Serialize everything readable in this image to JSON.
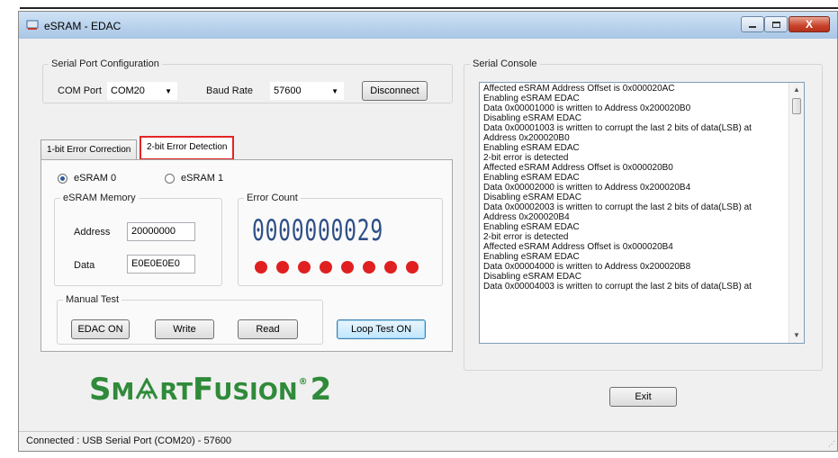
{
  "window": {
    "title": "eSRAM - EDAC",
    "controls": {
      "minimize": "–",
      "maximize": "□",
      "close": "X"
    }
  },
  "serial_config": {
    "legend": "Serial Port Configuration",
    "com_port_label": "COM Port",
    "com_port_value": "COM20",
    "baud_rate_label": "Baud Rate",
    "baud_rate_value": "57600",
    "disconnect_label": "Disconnect"
  },
  "tabs": [
    {
      "label": "1-bit Error Correction",
      "active": false
    },
    {
      "label": "2-bit Error Detection",
      "active": true
    }
  ],
  "panel": {
    "radio_esram0": "eSRAM 0",
    "radio_esram1": "eSRAM 1",
    "selected": "eSRAM 0",
    "memory_legend": "eSRAM Memory",
    "address_label": "Address",
    "address_value": "20000000",
    "data_label": "Data",
    "data_value": "E0E0E0E0",
    "error_count_legend": "Error Count",
    "error_count_value": "0000000029",
    "led_count": 8,
    "led_color": "#e02020",
    "manual_test_legend": "Manual Test",
    "edac_on_label": "EDAC ON",
    "write_label": "Write",
    "read_label": "Read",
    "loop_test_label": "Loop Test ON"
  },
  "console": {
    "legend": "Serial Console",
    "lines": [
      "Affected eSRAM Address Offset is 0x000020AC",
      "Enabling eSRAM EDAC",
      "Data 0x00001000 is written to Address 0x200020B0",
      "Disabling eSRAM EDAC",
      "Data 0x00001003 is written to corrupt the last 2 bits of data(LSB) at",
      "Address 0x200020B0",
      "Enabling eSRAM EDAC",
      "2-bit error is detected",
      "Affected eSRAM Address Offset is 0x000020B0",
      "Enabling eSRAM EDAC",
      "Data 0x00002000 is written to Address 0x200020B4",
      "Disabling eSRAM EDAC",
      "Data 0x00002003 is written to corrupt the last 2 bits of data(LSB) at",
      "Address 0x200020B4",
      "Enabling eSRAM EDAC",
      "2-bit error is detected",
      "Affected eSRAM Address Offset is 0x000020B4",
      "Enabling eSRAM EDAC",
      "Data 0x00004000 is written to Address 0x200020B8",
      "Disabling eSRAM EDAC",
      "Data 0x00004003 is written to corrupt the last 2 bits of data(LSB) at"
    ]
  },
  "logo": {
    "part1_big": "S",
    "part1_small": "M",
    "part1_rest": "RT",
    "part2_big": "F",
    "part2_small": "USION",
    "reg": "®",
    "number": "2",
    "color": "#2f8a3a"
  },
  "exit_label": "Exit",
  "status_bar": "Connected : USB Serial Port (COM20) - 57600",
  "colors": {
    "accent_highlight": "#e32626",
    "lcd": "#2f4f86"
  }
}
